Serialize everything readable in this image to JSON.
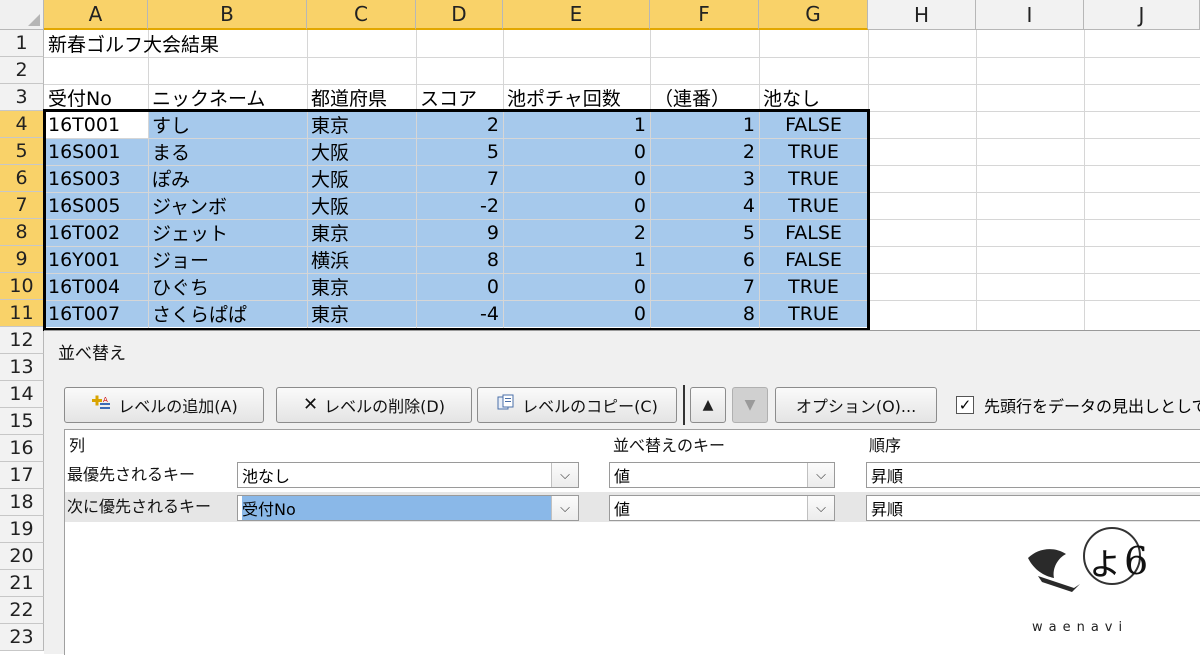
{
  "columns": [
    "A",
    "B",
    "C",
    "D",
    "E",
    "F",
    "G",
    "H",
    "I",
    "J"
  ],
  "rows": [
    "1",
    "2",
    "3",
    "4",
    "5",
    "6",
    "7",
    "8",
    "9",
    "10",
    "11",
    "12",
    "13",
    "14",
    "15",
    "16",
    "17",
    "18",
    "19",
    "20",
    "21",
    "22",
    "23"
  ],
  "sheet": {
    "title": "新春ゴルフ大会結果",
    "headers": [
      "受付No",
      "ニックネーム",
      "都道府県",
      "スコア",
      "池ポチャ回数",
      "（連番）",
      "池なし"
    ],
    "data": [
      [
        "16T001",
        "すし",
        "東京",
        "2",
        "1",
        "1",
        "FALSE"
      ],
      [
        "16S001",
        "まる",
        "大阪",
        "5",
        "0",
        "2",
        "TRUE"
      ],
      [
        "16S003",
        "ぽみ",
        "大阪",
        "7",
        "0",
        "3",
        "TRUE"
      ],
      [
        "16S005",
        "ジャンボ",
        "大阪",
        "-2",
        "0",
        "4",
        "TRUE"
      ],
      [
        "16T002",
        "ジェット",
        "東京",
        "9",
        "2",
        "5",
        "FALSE"
      ],
      [
        "16Y001",
        "ジョー",
        "横浜",
        "8",
        "1",
        "6",
        "FALSE"
      ],
      [
        "16T004",
        "ひぐち",
        "東京",
        "0",
        "0",
        "7",
        "TRUE"
      ],
      [
        "16T007",
        "さくらぱぱ",
        "東京",
        "-4",
        "0",
        "8",
        "TRUE"
      ]
    ]
  },
  "dialog": {
    "title": "並べ替え",
    "add_level": "レベルの追加(A)",
    "delete_level": "レベルの削除(D)",
    "copy_level": "レベルのコピー(C)",
    "up_arrow": "▲",
    "down_arrow": "▼",
    "options": "オプション(O)...",
    "header_checkbox_label": "先頭行をデータの見出しとして",
    "header_checkbox_checked": true,
    "col_header_column": "列",
    "col_header_key": "並べ替えのキー",
    "col_header_order": "順序",
    "levels": [
      {
        "label": "最優先されるキー",
        "column": "池なし",
        "key": "値",
        "order": "昇順"
      },
      {
        "label": "次に優先されるキー",
        "column": "受付No",
        "key": "値",
        "order": "昇順"
      }
    ]
  },
  "watermark": {
    "text": "waenavi"
  },
  "icons": {
    "add_level": "add-level-icon",
    "delete_level": "delete-x-icon",
    "copy_level": "copy-icon",
    "dropdown": "chevron-down-icon",
    "check": "checkmark-icon"
  }
}
